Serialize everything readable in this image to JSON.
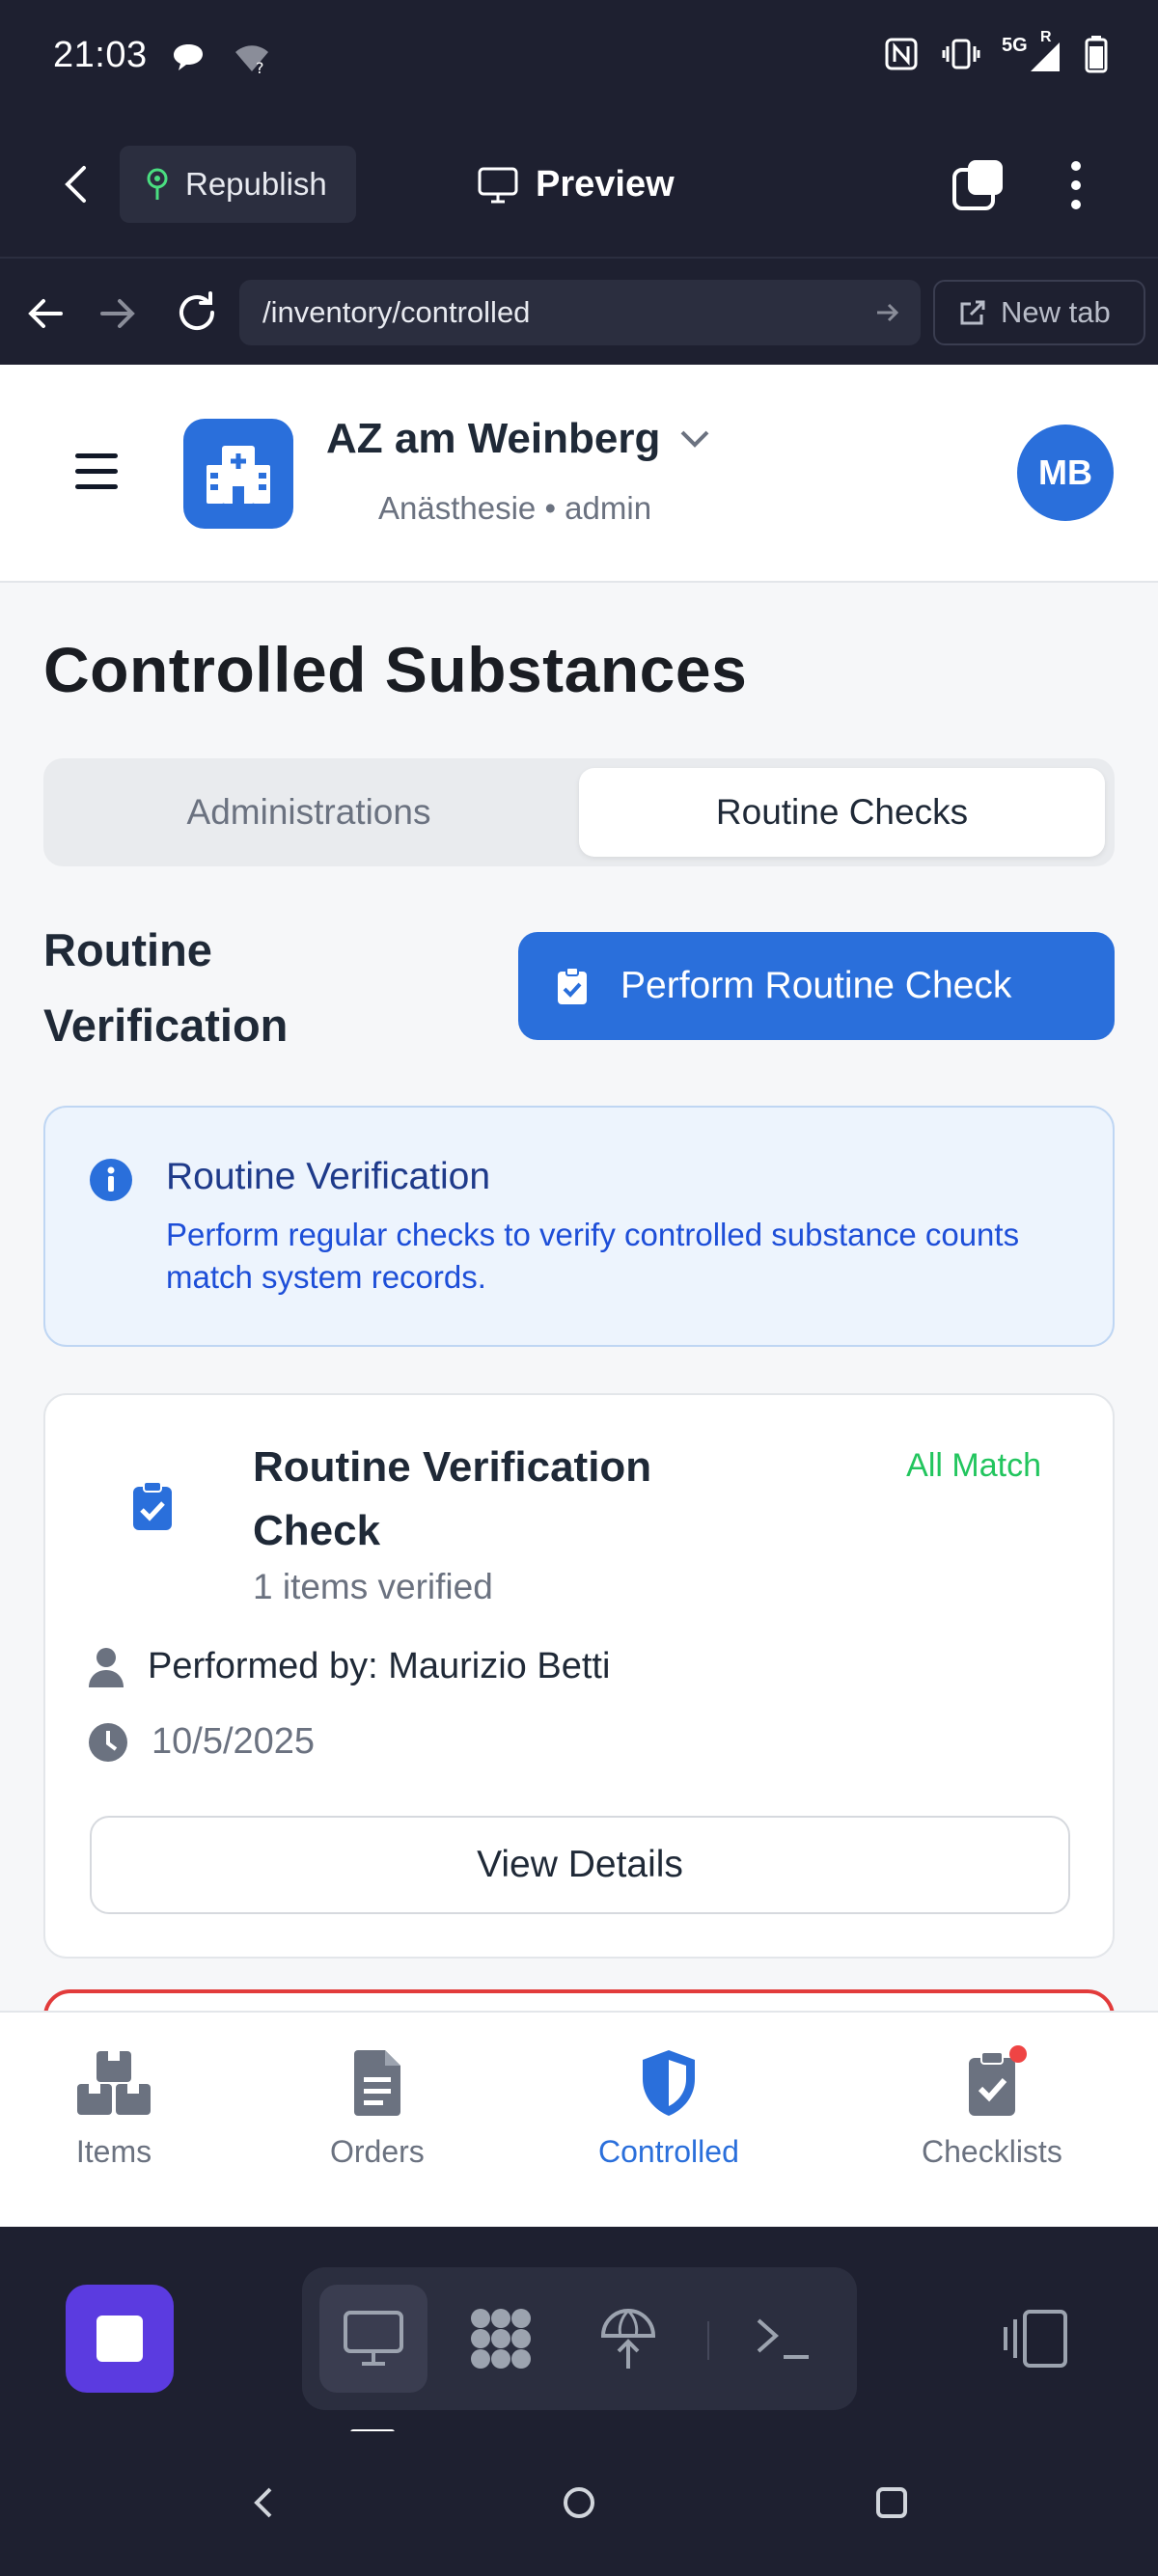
{
  "status_bar": {
    "time": "21:03",
    "network": "5G",
    "network_sup": "R",
    "icons": [
      "chat-bubble-icon",
      "wifi-question-icon",
      "nfc-icon",
      "vibrate-icon",
      "signal-icon",
      "battery-icon"
    ]
  },
  "app_toolbar": {
    "republish_label": "Republish",
    "preview_label": "Preview"
  },
  "url_bar": {
    "url": "/inventory/controlled",
    "new_tab_label": "New tab"
  },
  "site_header": {
    "org_name": "AZ am Weinberg",
    "org_sub": "Anästhesie • admin",
    "avatar_initials": "MB"
  },
  "page": {
    "title": "Controlled Substances",
    "tabs": [
      {
        "label": "Administrations",
        "active": false
      },
      {
        "label": "Routine Checks",
        "active": true
      }
    ],
    "section_title": "Routine Verification",
    "perform_button": "Perform Routine Check",
    "info": {
      "title": "Routine Verification",
      "text": "Perform regular checks to verify controlled substance counts match system records."
    },
    "check_card": {
      "title": "Routine Verification Check",
      "status": "All Match",
      "items_verified": "1 items verified",
      "performed_by": "Performed by: Maurizio Betti",
      "date": "10/5/2025",
      "details_button": "View Details"
    }
  },
  "bottom_nav": [
    {
      "label": "Items",
      "icon": "boxes-icon",
      "active": false
    },
    {
      "label": "Orders",
      "icon": "document-icon",
      "active": false
    },
    {
      "label": "Controlled",
      "icon": "shield-icon",
      "active": true
    },
    {
      "label": "Checklists",
      "icon": "clipboard-check-icon",
      "active": false,
      "notification": true
    }
  ],
  "colors": {
    "accent": "#2a6fdb",
    "success": "#22c55e",
    "danger": "#e23b3b",
    "chrome_bg": "#1e2030",
    "stop_button": "#5b3be0"
  }
}
